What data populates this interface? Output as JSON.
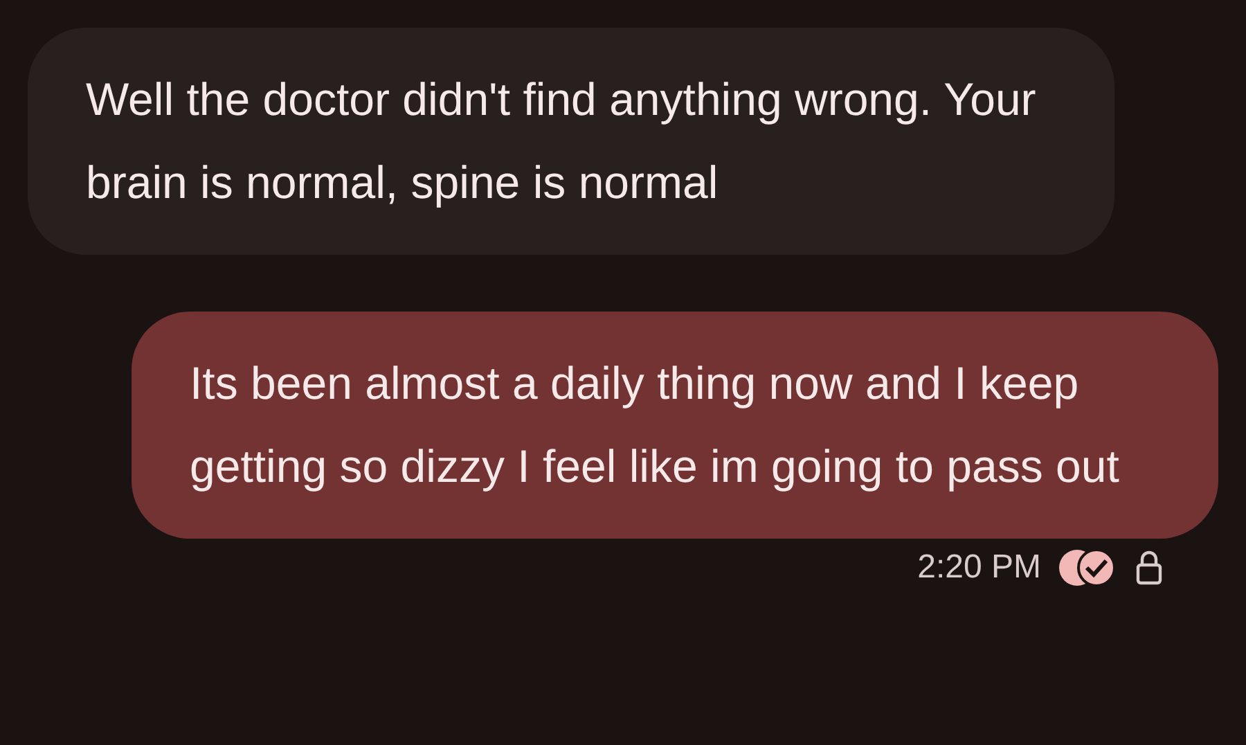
{
  "messages": [
    {
      "kind": "received",
      "text": "Well the doctor didn't find anything wrong. Your brain is normal, spine is normal"
    },
    {
      "kind": "sent",
      "text": "Its been almost a daily thing now and I keep getting so dizzy I feel like im going to pass out"
    }
  ],
  "status": {
    "time": "2:20 PM",
    "read": true,
    "encrypted": true
  }
}
